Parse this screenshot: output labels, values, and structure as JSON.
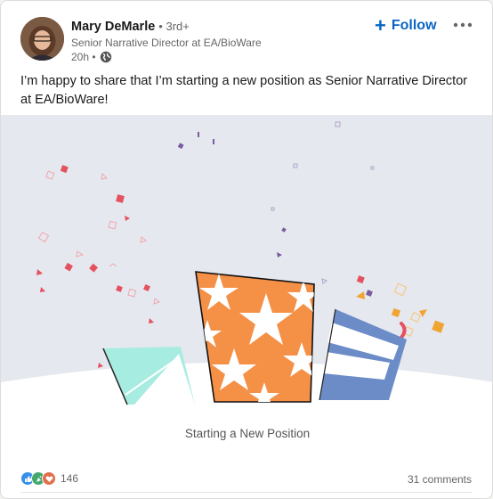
{
  "author": {
    "name": "Mary DeMarle",
    "degree": "• 3rd+",
    "headline": "Senior Narrative Director at EA/BioWare",
    "time": "20h •"
  },
  "actions": {
    "follow_label": "Follow",
    "follow_icon": "plus-icon",
    "more_icon": "ellipsis-icon"
  },
  "post": {
    "text": "I’m happy to share that I’m starting a new position as Senior Narrative Director at EA/BioWare!"
  },
  "media": {
    "caption": "Starting a New Position",
    "colors": {
      "background": "#e6e8ef",
      "teal": "#a7ece0",
      "orange": "#f59047",
      "blue": "#6b8cc7",
      "confetti_red": "#e4525f",
      "confetti_purple": "#7a5ca0",
      "confetti_gold": "#f0a532"
    }
  },
  "social": {
    "reaction_icons": [
      "like-icon",
      "celebrate-icon",
      "love-icon"
    ],
    "reaction_count": "146",
    "comments": "31 comments"
  }
}
